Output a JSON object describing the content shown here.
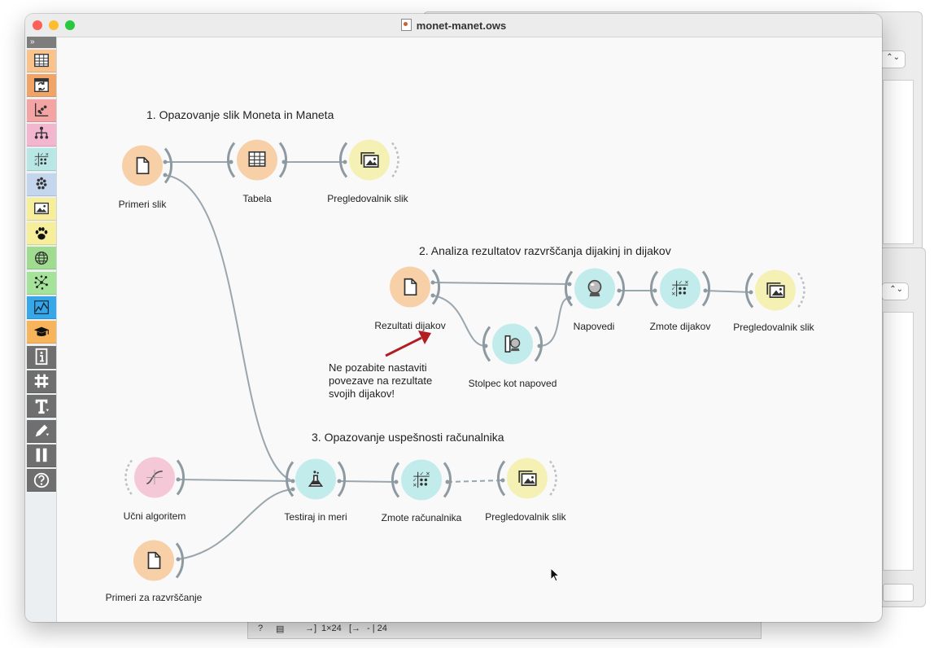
{
  "window": {
    "title": "monet-manet.ows"
  },
  "toolbox": {
    "expand": "»",
    "categories": [
      {
        "name": "Data",
        "icon": "table-icon",
        "color": "#f9c38b"
      },
      {
        "name": "Transform",
        "icon": "transform-icon",
        "color": "#f2a466"
      },
      {
        "name": "Visualize",
        "icon": "scatter-icon",
        "color": "#f5a4a4"
      },
      {
        "name": "Model",
        "icon": "tree-icon",
        "color": "#f2b6cf"
      },
      {
        "name": "Evaluate",
        "icon": "confusion-icon",
        "color": "#b8e7e6"
      },
      {
        "name": "Unsupervised",
        "icon": "cluster-icon",
        "color": "#c4d6ee"
      },
      {
        "name": "Image Analytics",
        "icon": "image-icon",
        "color": "#f6ee9b"
      },
      {
        "name": "Educational",
        "icon": "paw-icon",
        "color": "#f6ee9b"
      },
      {
        "name": "Geo",
        "icon": "globe-icon",
        "color": "#9fdc90"
      },
      {
        "name": "Networks",
        "icon": "network-icon",
        "color": "#a5e39b"
      },
      {
        "name": "Time Series",
        "icon": "timeseries-icon",
        "color": "#37a7e8"
      },
      {
        "name": "Educational 2",
        "icon": "mortarboard-icon",
        "color": "#f7b45a"
      },
      {
        "name": "Info",
        "icon": "info-icon",
        "color": "#6f6f6f"
      },
      {
        "name": "Grid",
        "icon": "hash-icon",
        "color": "#6f6f6f"
      },
      {
        "name": "Text",
        "icon": "text-icon",
        "color": "#6f6f6f"
      },
      {
        "name": "Draw",
        "icon": "pen-icon",
        "color": "#6f6f6f"
      },
      {
        "name": "Pause",
        "icon": "pause-icon",
        "color": "#6f6f6f"
      },
      {
        "name": "Help",
        "icon": "help-icon",
        "color": "#6f6f6f"
      }
    ]
  },
  "sections": {
    "s1": "1. Opazovanje slik Moneta in Maneta",
    "s2": "2. Analiza rezultatov razvrščanja dijakinj in dijakov",
    "s3": "3. Opazovanje uspešnosti računalnika"
  },
  "nodes": {
    "primeri_slik": "Primeri slik",
    "tabela": "Tabela",
    "pregled1": "Pregledovalnik slik",
    "rezultati": "Rezultati dijakov",
    "stolpec": "Stolpec kot napoved",
    "napovedi": "Napovedi",
    "zmote_dijakov": "Zmote dijakov",
    "pregled2": "Pregledovalnik slik",
    "ucni": "Učni algoritem",
    "testiraj": "Testiraj in meri",
    "zmote_rac": "Zmote računalnika",
    "pregled3": "Pregledovalnik slik",
    "primeri_razv": "Primeri za razvrščanje"
  },
  "note": "Ne pozabite nastaviti\npovezave na rezultate\nsvojih dijakov!",
  "statusbar": {
    "size_in": "1×24",
    "size_out": "- | 24"
  },
  "colors": {
    "data": "#f8d0a8",
    "evaluate": "#c2ecec",
    "image": "#f5f1b4",
    "model": "#f5c8d7",
    "link": "#9aa6ae",
    "arrow": "#b01e24"
  }
}
